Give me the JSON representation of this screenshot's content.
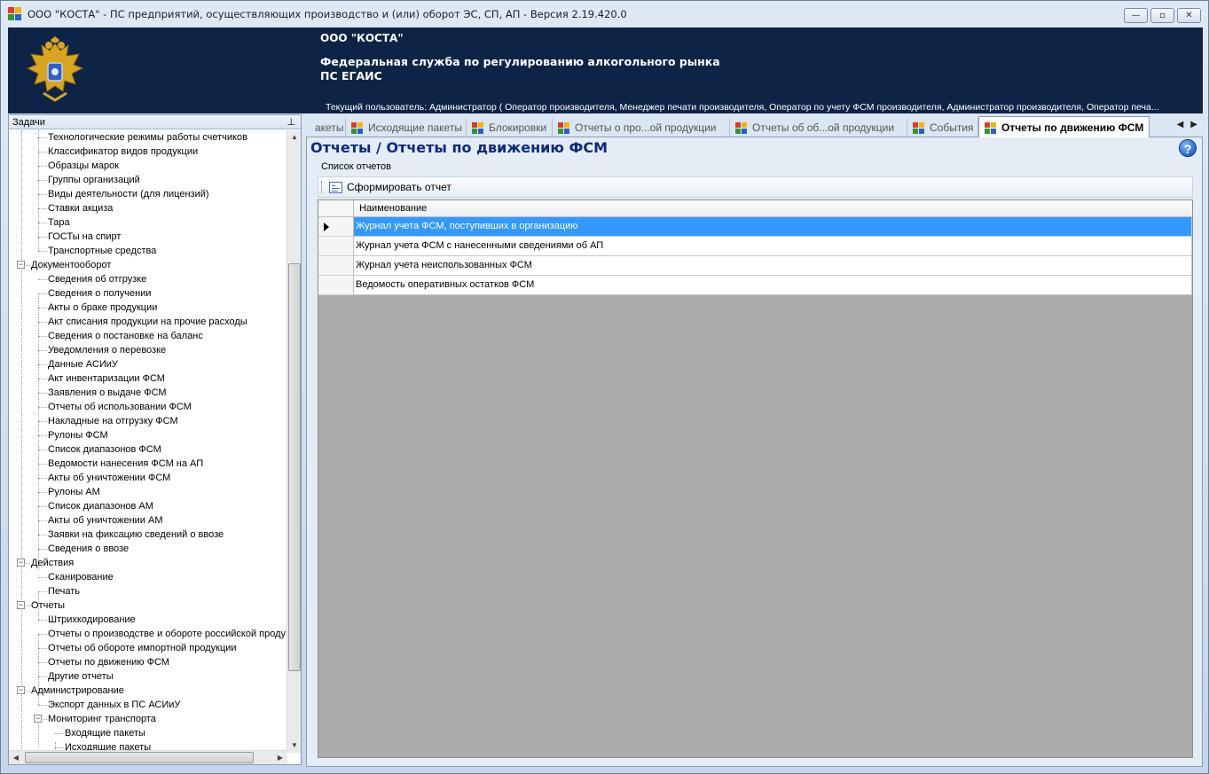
{
  "window": {
    "title": "ООО \"КОСТА\" - ПС предприятий, осуществляющих производство и (или) оборот ЭС, СП, АП - Версия 2.19.420.0",
    "controls": {
      "minimize": "—",
      "maximize": "▫",
      "close": "✕"
    }
  },
  "banner": {
    "organization": "ООО \"КОСТА\"",
    "service": "Федеральная служба по регулированию алкогольного рынка",
    "system": "ПС ЕГАИС",
    "current_user": "Текущий пользователь: Администратор ( Оператор производителя, Менеджер печати производителя, Оператор по учету ФСМ производителя, Администратор производителя, Оператор печа..."
  },
  "tasks_panel": {
    "title": "Задачи",
    "pin_glyph": "⊥",
    "tree": [
      {
        "level": 1,
        "label": "Технологические режимы работы счетчиков"
      },
      {
        "level": 1,
        "label": "Классификатор видов продукции"
      },
      {
        "level": 1,
        "label": "Образцы марок"
      },
      {
        "level": 1,
        "label": "Группы организаций"
      },
      {
        "level": 1,
        "label": "Виды деятельности (для лицензий)"
      },
      {
        "level": 1,
        "label": "Ставки акциза"
      },
      {
        "level": 1,
        "label": "Тара"
      },
      {
        "level": 1,
        "label": "ГОСТы на спирт"
      },
      {
        "level": 1,
        "label": "Транспортные средства"
      },
      {
        "level": 0,
        "label": "Документооборот",
        "expander": "−"
      },
      {
        "level": 1,
        "label": "Сведения об отгрузке"
      },
      {
        "level": 1,
        "label": "Сведения о получении"
      },
      {
        "level": 1,
        "label": "Акты о браке продукции"
      },
      {
        "level": 1,
        "label": "Акт списания продукции на прочие расходы"
      },
      {
        "level": 1,
        "label": "Сведения о постановке на баланс"
      },
      {
        "level": 1,
        "label": "Уведомления о перевозке"
      },
      {
        "level": 1,
        "label": "Данные АСИиУ"
      },
      {
        "level": 1,
        "label": "Акт инвентаризации ФСМ"
      },
      {
        "level": 1,
        "label": "Заявления о выдаче ФСМ"
      },
      {
        "level": 1,
        "label": "Отчеты об использовании ФСМ"
      },
      {
        "level": 1,
        "label": "Накладные на отгрузку ФСМ"
      },
      {
        "level": 1,
        "label": "Рулоны ФСМ"
      },
      {
        "level": 1,
        "label": "Список диапазонов ФСМ"
      },
      {
        "level": 1,
        "label": "Ведомости нанесения ФСМ на АП"
      },
      {
        "level": 1,
        "label": "Акты об уничтожении ФСМ"
      },
      {
        "level": 1,
        "label": "Рулоны АМ"
      },
      {
        "level": 1,
        "label": "Список диапазонов АМ"
      },
      {
        "level": 1,
        "label": "Акты об уничтожении АМ"
      },
      {
        "level": 1,
        "label": "Заявки на фиксацию сведений о ввозе"
      },
      {
        "level": 1,
        "label": "Сведения о ввозе"
      },
      {
        "level": 0,
        "label": "Действия",
        "expander": "−"
      },
      {
        "level": 1,
        "label": "Сканирование"
      },
      {
        "level": 1,
        "label": "Печать"
      },
      {
        "level": 0,
        "label": "Отчеты",
        "expander": "−"
      },
      {
        "level": 1,
        "label": "Штрихкодирование"
      },
      {
        "level": 1,
        "label": "Отчеты о производстве и обороте российской проду"
      },
      {
        "level": 1,
        "label": "Отчеты об обороте импортной продукции"
      },
      {
        "level": 1,
        "label": "Отчеты по движению ФСМ"
      },
      {
        "level": 1,
        "label": "Другие отчеты"
      },
      {
        "level": 0,
        "label": "Администрирование",
        "expander": "−"
      },
      {
        "level": 1,
        "label": "Экспорт данных в ПС АСИиУ"
      },
      {
        "level": 1,
        "label": "Мониторинг транспорта",
        "expander": "−"
      },
      {
        "level": 2,
        "label": "Входящие пакеты"
      },
      {
        "level": 2,
        "label": "Исходящие пакеты"
      }
    ]
  },
  "tabs": [
    {
      "label": "акеты",
      "icon": false
    },
    {
      "label": "Исходящие пакеты",
      "icon": true
    },
    {
      "label": "Блокировки",
      "icon": true
    },
    {
      "label": "Отчеты о про...ой продукции",
      "icon": true
    },
    {
      "label": "Отчеты об об...ой продукции",
      "icon": true
    },
    {
      "label": "События",
      "icon": true
    },
    {
      "label": "Отчеты по движению ФСМ",
      "icon": true,
      "active": true
    }
  ],
  "tab_nav": {
    "prev": "◀",
    "next": "▶"
  },
  "content": {
    "page_title": "Отчеты / Отчеты по движению ФСМ",
    "help_glyph": "?",
    "section_label": "Список отчетов",
    "toolbar": {
      "form_report_label": "Сформировать отчет"
    },
    "grid": {
      "column_header": "Наименование",
      "rows": [
        {
          "name": "Журнал учета ФСМ, поступивших в организацию",
          "selected": true
        },
        {
          "name": "Журнал учета ФСМ с нанесенными сведениями об АП",
          "selected": false
        },
        {
          "name": "Журнал учета неиспользованных ФСМ",
          "selected": false
        },
        {
          "name": "Ведомость оперативных остатков ФСМ",
          "selected": false
        }
      ]
    }
  },
  "colors": {
    "banner_bg": "#0e2447",
    "selected_row": "#3399ff",
    "title_blue": "#0c2a7a"
  }
}
